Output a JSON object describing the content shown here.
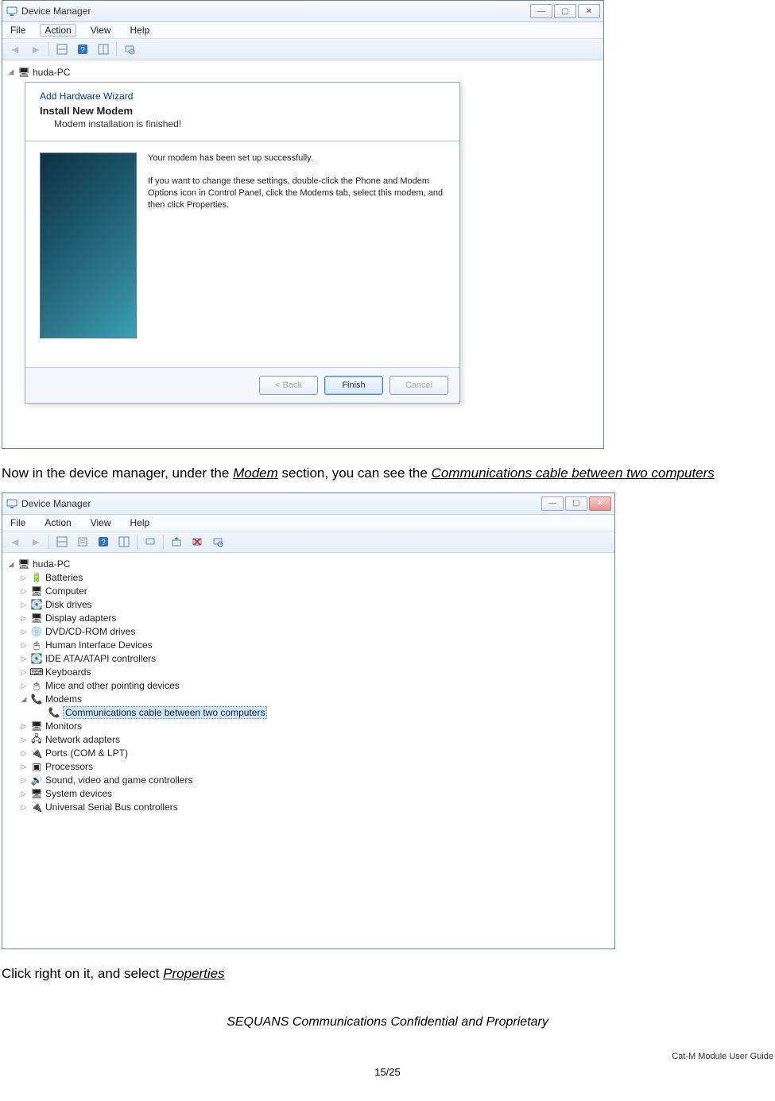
{
  "screenshot1": {
    "title": "Device Manager",
    "menu": {
      "file": "File",
      "action": "Action",
      "view": "View",
      "help": "Help"
    },
    "root_node": "huda-PC",
    "wizard": {
      "bar_title": "Add Hardware Wizard",
      "heading": "Install New Modem",
      "subheading": "Modem installation is finished!",
      "line1": "Your modem has been set up successfully.",
      "line2": "If you want to change these settings, double-click the Phone and Modem Options icon in Control Panel, click the Modems tab, select this modem, and then click Properties.",
      "btn_back": "< Back",
      "btn_finish": "Finish",
      "btn_cancel": "Cancel"
    }
  },
  "para1": {
    "pre": "Now in the device manager, under the ",
    "modem": "Modem",
    "mid": " section, you can see the ",
    "cable": "Communications cable between two computers"
  },
  "screenshot2": {
    "title": "Device Manager",
    "menu": {
      "file": "File",
      "action": "Action",
      "view": "View",
      "help": "Help"
    },
    "root_node": "huda-PC",
    "nodes": {
      "batteries": "Batteries",
      "computer": "Computer",
      "disk": "Disk drives",
      "display": "Display adapters",
      "dvd": "DVD/CD-ROM drives",
      "hid": "Human Interface Devices",
      "ide": "IDE ATA/ATAPI controllers",
      "keyboards": "Keyboards",
      "mice": "Mice and other pointing devices",
      "modems": "Modems",
      "comm_cable": "Communications cable between two computers",
      "monitors": "Monitors",
      "network": "Network adapters",
      "ports": "Ports (COM & LPT)",
      "processors": "Processors",
      "sound": "Sound, video and game controllers",
      "system": "System devices",
      "usb": "Universal Serial Bus controllers"
    }
  },
  "para2": {
    "pre": "Click right on it, and select ",
    "prop": "Properties"
  },
  "footer": {
    "confidential": "SEQUANS Communications Confidential and Proprietary",
    "guide": "Cat-M Module User Guide",
    "page": "15/25"
  }
}
